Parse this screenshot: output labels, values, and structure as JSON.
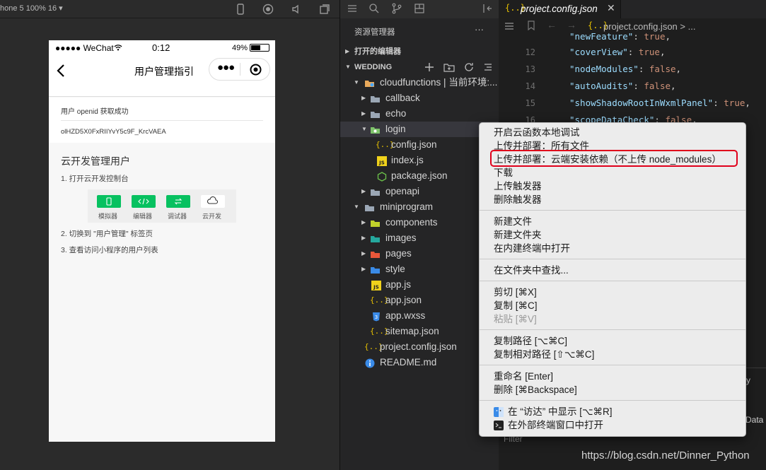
{
  "simulator": {
    "device_label": "hone 5 100% 16 ▾",
    "status": {
      "carrier": "●●●●● WeChat",
      "time": "0:12",
      "battery": "49%"
    },
    "nav": {
      "title": "用户管理指引"
    },
    "openid": {
      "label": "用户 openid 获取成功",
      "value": "olHZD5X0FxRIIYvY5c9F_KrcVAEA"
    },
    "guide": {
      "title": "云开发管理用户",
      "step1": "1. 打开云开发控制台",
      "tools": [
        "模拟器",
        "编辑器",
        "调试器",
        "云开发"
      ],
      "step2": "2. 切换到 \"用户管理\" 标签页",
      "step3": "3. 查看访问小程序的用户列表"
    }
  },
  "explorer": {
    "title": "资源管理器",
    "more": "···",
    "open_editors": "打开的编辑器",
    "workspace": "WEDDING",
    "tree": [
      {
        "label": "cloudfunctions | 当前环境:...",
        "type": "folder-open"
      },
      {
        "label": "callback",
        "type": "folder"
      },
      {
        "label": "echo",
        "type": "folder"
      },
      {
        "label": "login",
        "type": "folder-open"
      },
      {
        "label": "config.json",
        "type": "json"
      },
      {
        "label": "index.js",
        "type": "js"
      },
      {
        "label": "package.json",
        "type": "npm"
      },
      {
        "label": "openapi",
        "type": "folder"
      },
      {
        "label": "miniprogram",
        "type": "folder-open"
      },
      {
        "label": "components",
        "type": "folder"
      },
      {
        "label": "images",
        "type": "folder"
      },
      {
        "label": "pages",
        "type": "folder"
      },
      {
        "label": "style",
        "type": "folder"
      },
      {
        "label": "app.js",
        "type": "js"
      },
      {
        "label": "app.json",
        "type": "json"
      },
      {
        "label": "app.wxss",
        "type": "css"
      },
      {
        "label": "sitemap.json",
        "type": "json"
      },
      {
        "label": "project.config.json",
        "type": "json"
      },
      {
        "label": "README.md",
        "type": "info"
      }
    ]
  },
  "editor": {
    "tab_title": "project.config.json",
    "breadcrumb": "project.config.json > ...",
    "lines": [
      {
        "n": "",
        "key": "\"newFeature\"",
        "val": "true"
      },
      {
        "n": "12",
        "key": "\"coverView\"",
        "val": "true"
      },
      {
        "n": "13",
        "key": "\"nodeModules\"",
        "val": "false"
      },
      {
        "n": "14",
        "key": "\"autoAudits\"",
        "val": "false"
      },
      {
        "n": "15",
        "key": "\"showShadowRootInWxmlPanel\"",
        "val": "true"
      },
      {
        "n": "16",
        "key": "\"scopeDataCheck\"",
        "val": "false"
      }
    ],
    "right_edge_texts": [
      "y",
      "Data"
    ],
    "filter_label": "Filter"
  },
  "context_menu": {
    "groups": [
      [
        "开启云函数本地调试",
        "上传并部署：所有文件",
        "上传并部署：云端安装依赖（不上传 node_modules）",
        "下载",
        "上传触发器",
        "删除触发器"
      ],
      [
        "新建文件",
        "新建文件夹",
        "在内建终端中打开"
      ],
      [
        "在文件夹中查找..."
      ],
      [
        "剪切 [⌘X]",
        "复制 [⌘C]",
        "粘贴 [⌘V]"
      ],
      [
        "复制路径 [⌥⌘C]",
        "复制相对路径 [⇧⌥⌘C]"
      ],
      [
        "重命名 [Enter]",
        "删除 [⌘Backspace]"
      ],
      [
        "在 “访达” 中显示 [⌥⌘R]",
        "在外部终端窗口中打开"
      ]
    ]
  },
  "watermark": "https://blog.csdn.net/Dinner_Python",
  "colors": {
    "highlight": "#e0001b",
    "wechat_green": "#07c160"
  }
}
